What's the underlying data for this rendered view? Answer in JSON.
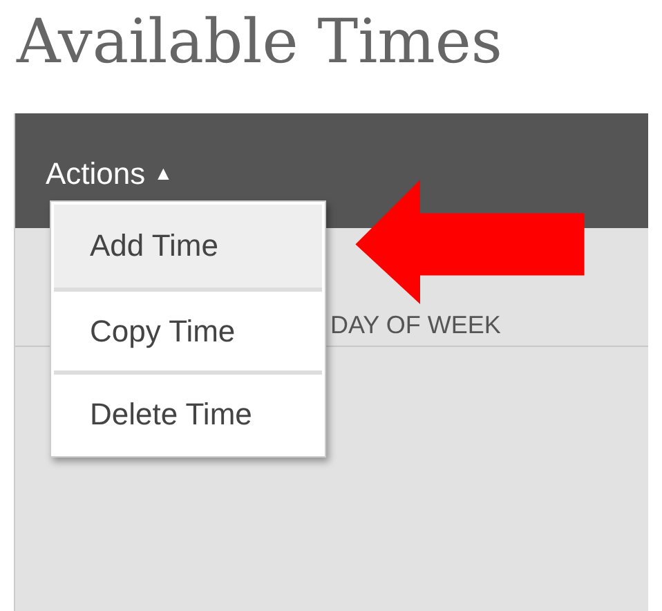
{
  "page": {
    "title": "Available Times"
  },
  "toolbar": {
    "menu_label": "Actions",
    "caret": "▲",
    "expanded": true
  },
  "table": {
    "columns": [
      "DAY OF WEEK"
    ]
  },
  "menu": {
    "items": [
      {
        "label": "Add Time",
        "selected": true
      },
      {
        "label": "Copy Time",
        "selected": false
      },
      {
        "label": "Delete Time",
        "selected": false
      }
    ]
  }
}
